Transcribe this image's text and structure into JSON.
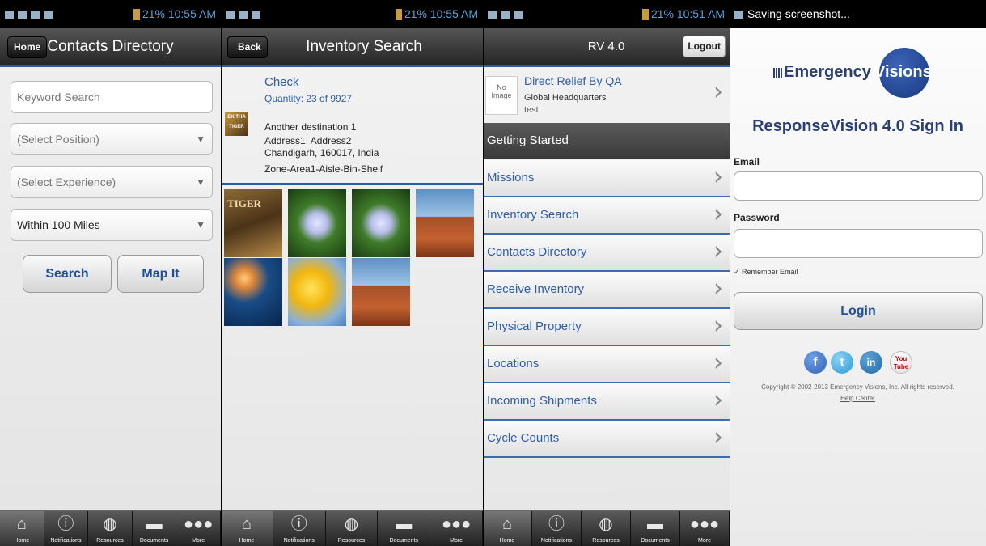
{
  "screen1": {
    "status": {
      "text": "21% 10:55 AM"
    },
    "title": "Contacts Directory",
    "nav_button": "Home",
    "keyword_placeholder": "Keyword Search",
    "position_select": "(Select Position)",
    "experience_select": "(Select Experience)",
    "distance_select": "Within 100 Miles",
    "search_button": "Search",
    "map_button": "Map It"
  },
  "screen2": {
    "status": {
      "text": "21% 10:55 AM"
    },
    "title": "Inventory Search",
    "nav_button": "Back",
    "item_title": "Check",
    "item_quantity": "Quantity: 23 of 9927",
    "thumb_label": "EK THA TIGER",
    "destination": "Another destination 1",
    "address1": "Address1, Address2",
    "address2": "Chandigarh, 160017, India",
    "zone": "Zone-Area1-Aisle-Bin-Shelf",
    "gallery_tiger_text": "TIGER"
  },
  "screen3": {
    "status": {
      "text": "21% 10:51 AM"
    },
    "title": "RV 4.0",
    "logout_button": "Logout",
    "no_image_label": "No Image",
    "org_name": "Direct Relief By QA",
    "org_location": "Global Headquarters",
    "org_note": "test",
    "section_header": "Getting Started",
    "menu": [
      "Missions",
      "Inventory Search",
      "Contacts Directory",
      "Receive Inventory",
      "Physical Property",
      "Locations",
      "Incoming Shipments",
      "Cycle Counts"
    ]
  },
  "screen4": {
    "status": {
      "text": "Saving screenshot..."
    },
    "logo_text": "Emergency",
    "logo_accent": "Visions",
    "heading": "ResponseVision 4.0 Sign In",
    "email_label": "Email",
    "password_label": "Password",
    "remember_label": "Remember Email",
    "login_button": "Login",
    "social": {
      "facebook": "f",
      "twitter": "t",
      "linkedin": "in",
      "youtube": "You Tube"
    },
    "copyright": "Copyright © 2002-2013 Emergency Visions, Inc. All rights reserved.",
    "help_link": "Help Center"
  },
  "tabbar": [
    "Home",
    "Notifications",
    "Resources",
    "Documents",
    "More"
  ],
  "colors": {
    "accent": "#2e5b9e",
    "link_text": "#2d5da5",
    "brand": "#2b3f73"
  }
}
